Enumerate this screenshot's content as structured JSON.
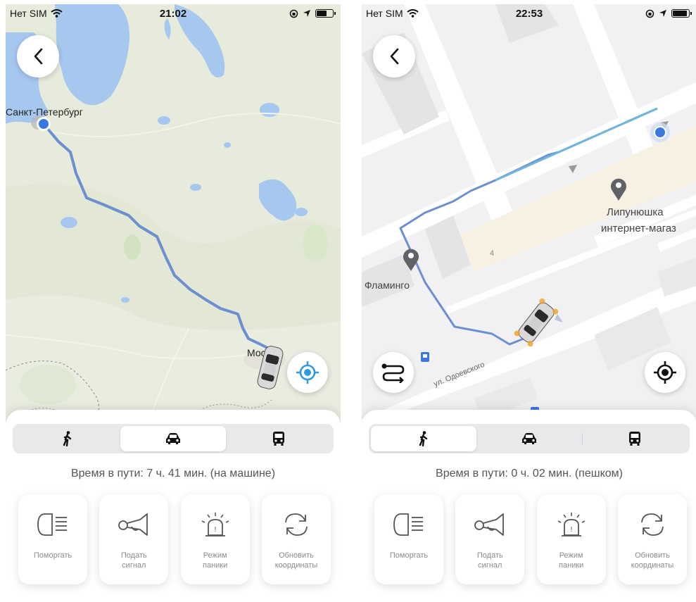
{
  "screens": [
    {
      "status": {
        "carrier": "Нет SIM",
        "time": "21:02"
      },
      "map_labels": {
        "city_start": "Санкт-Петербург",
        "city_end": "Москва"
      },
      "tabs": [
        {
          "name": "walk",
          "icon": "walking-person-icon"
        },
        {
          "name": "car",
          "icon": "car-icon"
        },
        {
          "name": "bus",
          "icon": "bus-icon"
        }
      ],
      "active_tab": "car",
      "travel_time": "Время в пути: 7 ч. 41 мин. (на машине)",
      "actions": [
        {
          "label": "Поморгать",
          "icon": "headlight-icon"
        },
        {
          "label": "Подать\nсигнал",
          "icon": "horn-icon"
        },
        {
          "label": "Режим\nпаники",
          "icon": "siren-icon"
        },
        {
          "label": "Обновить\nкоординаты",
          "icon": "refresh-icon"
        }
      ]
    },
    {
      "status": {
        "carrier": "Нет SIM",
        "time": "22:53"
      },
      "map_labels": {
        "shop": "Липунюшка\nинтернет-магаз",
        "flamingo": "Фламинго",
        "street": "ул. Одоевского",
        "house": "4"
      },
      "tabs": [
        {
          "name": "walk",
          "icon": "walking-person-icon"
        },
        {
          "name": "car",
          "icon": "car-icon"
        },
        {
          "name": "bus",
          "icon": "bus-icon"
        }
      ],
      "active_tab": "walk",
      "travel_time": "Время в пути: 0 ч. 02 мин. (пешком)",
      "actions": [
        {
          "label": "Поморгать",
          "icon": "headlight-icon"
        },
        {
          "label": "Подать\nсигнал",
          "icon": "horn-icon"
        },
        {
          "label": "Режим\nпаники",
          "icon": "siren-icon"
        },
        {
          "label": "Обновить\nкоординаты",
          "icon": "refresh-icon"
        }
      ]
    }
  ],
  "colors": {
    "route_blue": "#6b8fd0",
    "route_light_blue": "#6fb6d8",
    "location_blue": "#3a78e0",
    "locate_button_blue": "#2f9ae0",
    "water": "#a6c8ee",
    "land": "#e7ecdc",
    "city_map_bg": "#f1f1f3"
  }
}
